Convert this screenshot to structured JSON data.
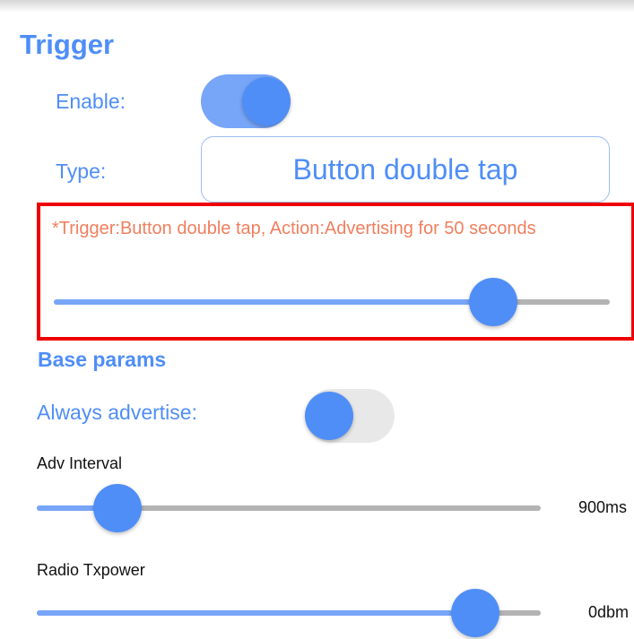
{
  "section_title": "Trigger",
  "enable": {
    "label": "Enable:",
    "on": true
  },
  "type": {
    "label": "Type:",
    "value": "Button double tap"
  },
  "trigger_note": "*Trigger:Button double tap, Action:Advertising for 50 seconds",
  "advertising_slider": {
    "fraction": 0.79
  },
  "base_params": {
    "title": "Base params",
    "always_advertise": {
      "label": "Always advertise:",
      "on": false
    },
    "adv_interval": {
      "label": "Adv Interval",
      "value": "900ms",
      "fraction": 0.16
    },
    "radio_txpower": {
      "label": "Radio Txpower",
      "value": "0dbm",
      "fraction": 0.87
    }
  },
  "colors": {
    "accent": "#4f8ef7",
    "accent_light": "#77a5f8",
    "note_orange": "#f07f5e",
    "highlight_red": "#ee0000"
  }
}
